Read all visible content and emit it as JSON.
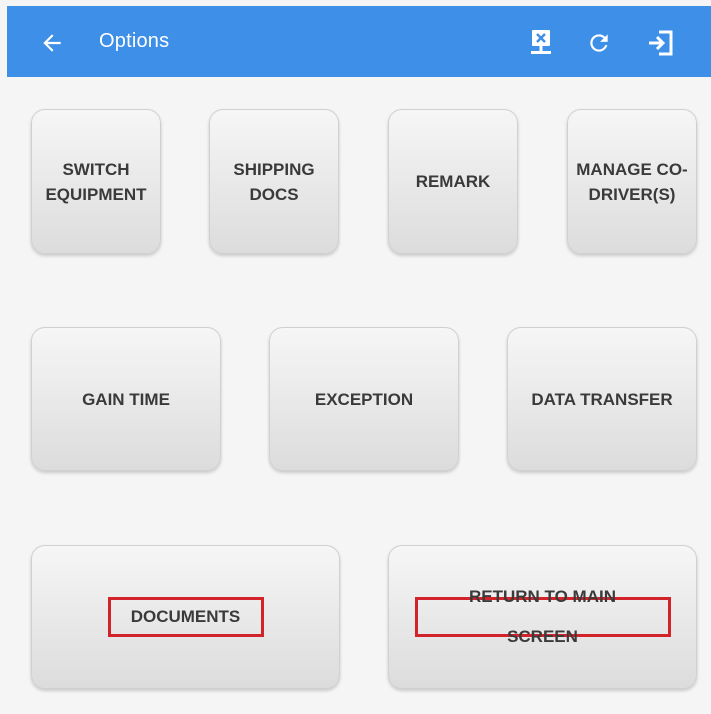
{
  "header": {
    "title": "Options",
    "back_icon": "arrow-left-icon",
    "actions": [
      {
        "icon": "disconnect-device-icon"
      },
      {
        "icon": "refresh-icon"
      },
      {
        "icon": "logout-icon"
      }
    ],
    "color": "#3e8fe8"
  },
  "buttons": {
    "switch_equipment": "SWITCH EQUIPMENT",
    "shipping_docs": "SHIPPING DOCS",
    "remark": "REMARK",
    "manage_codrivers": "MANAGE CO-DRIVER(S)",
    "gain_time": "GAIN TIME",
    "exception": "EXCEPTION",
    "data_transfer": "DATA TRANSFER",
    "documents": "DOCUMENTS",
    "return_main": "RETURN TO MAIN SCREEN"
  },
  "highlight_color": "#d2232a"
}
